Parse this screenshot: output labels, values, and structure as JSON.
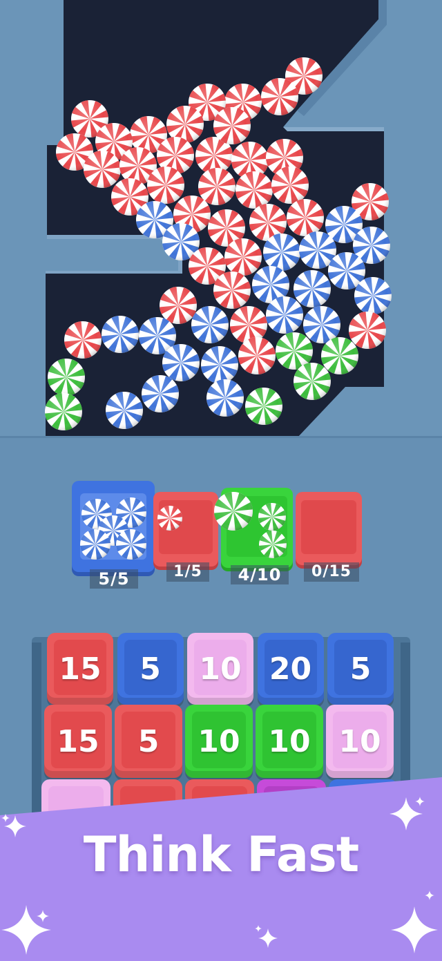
{
  "colors": {
    "background": "#6b95b8",
    "pit": "#1a2236",
    "ball_red": "#e8464a",
    "ball_blue": "#3f73d8",
    "ball_green": "#3cbd3c",
    "crate_red": "#ea5a5c",
    "crate_blue": "#3f73e0",
    "crate_pink": "#f3b9ee",
    "crate_green": "#39d43c",
    "crate_magenta": "#c64bd9",
    "banner": "#a98bf0"
  },
  "collectors": [
    {
      "id": "blue",
      "color": "blue",
      "label": "5/5",
      "filled": 5,
      "capacity": 5,
      "active": true
    },
    {
      "id": "red",
      "color": "red",
      "label": "1/5",
      "filled": 1,
      "capacity": 5,
      "active": false
    },
    {
      "id": "green",
      "color": "green",
      "label": "4/10",
      "filled": 4,
      "capacity": 10,
      "active": false
    },
    {
      "id": "red2",
      "color": "red",
      "label": "0/15",
      "filled": 0,
      "capacity": 15,
      "active": false
    }
  ],
  "crates": {
    "row1": [
      {
        "color": "red",
        "value": "15"
      },
      {
        "color": "blue",
        "value": "5"
      },
      {
        "color": "pink",
        "value": "10"
      },
      {
        "color": "blue",
        "value": "20"
      },
      {
        "color": "blue",
        "value": "5"
      }
    ],
    "row2": [
      {
        "color": "red",
        "value": "15"
      },
      {
        "color": "red",
        "value": "5"
      },
      {
        "color": "green",
        "value": "10"
      },
      {
        "color": "green",
        "value": "10"
      },
      {
        "color": "pink",
        "value": "10"
      }
    ],
    "row3": [
      {
        "color": "pink"
      },
      {
        "color": "red"
      },
      {
        "color": "red"
      },
      {
        "color": "magenta"
      },
      {
        "color": "blue"
      }
    ]
  },
  "banner": {
    "text": "Think Fast"
  },
  "icons": [
    "sparkle-icon"
  ]
}
